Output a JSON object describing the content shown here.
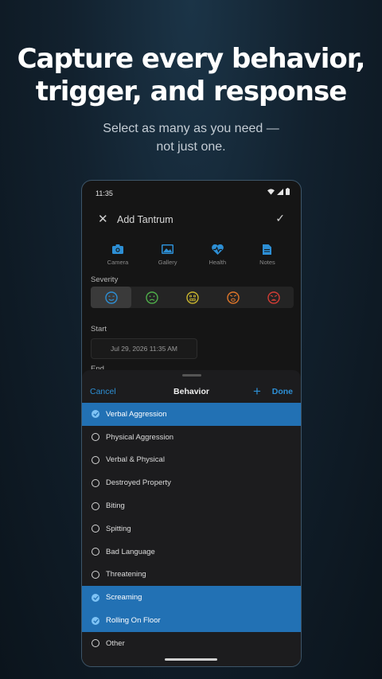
{
  "promo": {
    "headline_line1": "Capture every behavior,",
    "headline_line2": "trigger, and response",
    "subline_line1": "Select as many as you need —",
    "subline_line2": "not just one."
  },
  "status_bar": {
    "time": "11:35",
    "icons": [
      "wifi-icon",
      "signal-icon",
      "battery-icon"
    ]
  },
  "app_bar": {
    "title": "Add Tantrum",
    "close_icon": "close-icon",
    "confirm_icon": "check-icon"
  },
  "attachments": [
    {
      "label": "Camera",
      "icon": "camera-icon"
    },
    {
      "label": "Gallery",
      "icon": "gallery-icon"
    },
    {
      "label": "Health",
      "icon": "health-icon"
    },
    {
      "label": "Notes",
      "icon": "notes-icon"
    }
  ],
  "severity": {
    "label": "Severity",
    "levels": [
      {
        "icon": "calm-face-icon",
        "color": "#2d8fd5",
        "selected": true
      },
      {
        "icon": "frown-face-icon",
        "color": "#4fae4a",
        "selected": false
      },
      {
        "icon": "grimace-face-icon",
        "color": "#c9b52e",
        "selected": false
      },
      {
        "icon": "angry-face-icon",
        "color": "#e0772a",
        "selected": false
      },
      {
        "icon": "furious-face-icon",
        "color": "#d43d35",
        "selected": false
      }
    ]
  },
  "start": {
    "label": "Start",
    "value": "Jul 29, 2026 11:35 AM"
  },
  "end": {
    "label": "End"
  },
  "sheet": {
    "cancel_label": "Cancel",
    "title": "Behavior",
    "add_icon": "plus-icon",
    "done_label": "Done",
    "options": [
      {
        "label": "Verbal Aggression",
        "selected": true
      },
      {
        "label": "Physical Aggression",
        "selected": false
      },
      {
        "label": "Verbal & Physical",
        "selected": false
      },
      {
        "label": "Destroyed Property",
        "selected": false
      },
      {
        "label": "Biting",
        "selected": false
      },
      {
        "label": "Spitting",
        "selected": false
      },
      {
        "label": "Bad Language",
        "selected": false
      },
      {
        "label": "Threatening",
        "selected": false
      },
      {
        "label": "Screaming",
        "selected": true
      },
      {
        "label": "Rolling On Floor",
        "selected": true
      },
      {
        "label": "Other",
        "selected": false
      }
    ]
  },
  "colors": {
    "accent": "#2d8fd5",
    "selected_row": "#2271b4",
    "sheet_bg": "#1c1c1e"
  }
}
